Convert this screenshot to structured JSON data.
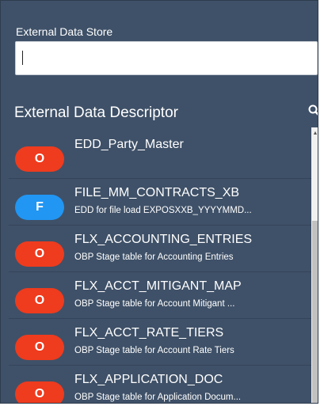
{
  "store": {
    "label": "External Data Store",
    "value": ""
  },
  "descriptor": {
    "title": "External Data Descriptor"
  },
  "items": [
    {
      "badge": "O",
      "badge_color": "#ef3b1e",
      "name": "EDD_Party_Master",
      "desc": ""
    },
    {
      "badge": "F",
      "badge_color": "#2196f3",
      "name": "FILE_MM_CONTRACTS_XB",
      "desc": "EDD for file load EXPOSXXB_YYYYMMD..."
    },
    {
      "badge": "O",
      "badge_color": "#ef3b1e",
      "name": "FLX_ACCOUNTING_ENTRIES",
      "desc": "OBP Stage table for Accounting Entries"
    },
    {
      "badge": "O",
      "badge_color": "#ef3b1e",
      "name": "FLX_ACCT_MITIGANT_MAP",
      "desc": "OBP Stage table for Account Mitigant ..."
    },
    {
      "badge": "O",
      "badge_color": "#ef3b1e",
      "name": "FLX_ACCT_RATE_TIERS",
      "desc": "OBP Stage table for Account Rate Tiers"
    },
    {
      "badge": "O",
      "badge_color": "#ef3b1e",
      "name": "FLX_APPLICATION_DOC",
      "desc": "OBP Stage table for Application Docum..."
    }
  ],
  "colors": {
    "panel_bg": "#3f5168",
    "badge_oracle": "#ef3b1e",
    "badge_file": "#2196f3"
  },
  "icons": {
    "search": "search-icon",
    "scroll_up": "scroll-up-arrow-icon"
  }
}
